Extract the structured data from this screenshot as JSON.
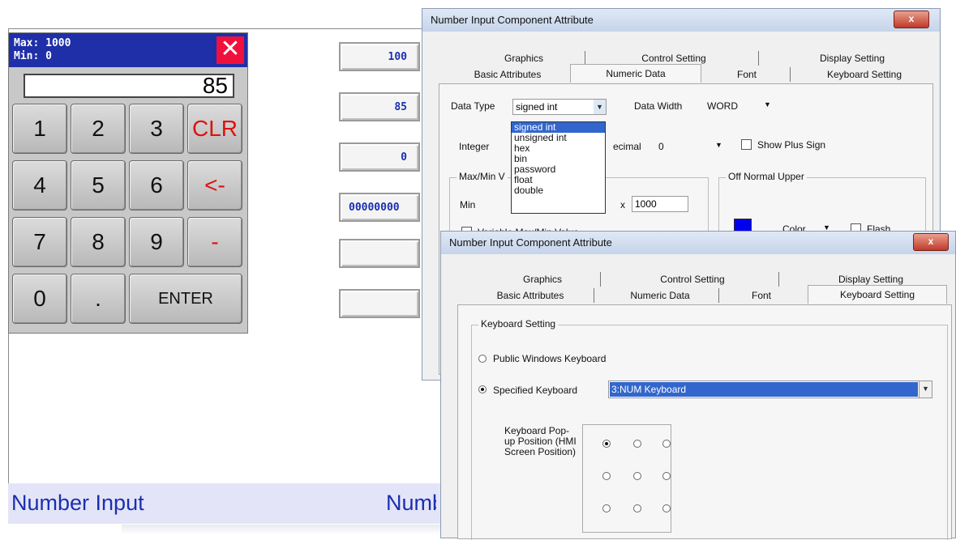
{
  "hmi": {
    "fields": [
      "100",
      "85",
      "0",
      "00000000",
      "",
      ""
    ],
    "bottom_label_left": "Number Input",
    "bottom_label_right": "Numb"
  },
  "keypad": {
    "max_label": "Max: 1000",
    "min_label": "Min: 0",
    "display_value": "85",
    "close_glyph": "✕",
    "keys": [
      "1",
      "2",
      "3",
      "CLR",
      "4",
      "5",
      "6",
      "<-",
      "7",
      "8",
      "9",
      "-",
      "0",
      ".",
      "ENTER"
    ]
  },
  "dialog1": {
    "title": "Number Input Component Attribute",
    "close": "x",
    "tabs_row1": [
      "Graphics",
      "Control Setting",
      "Display Setting"
    ],
    "tabs_row2": [
      "Basic Attributes",
      "Numeric Data",
      "Font",
      "Keyboard Setting"
    ],
    "active_tab": "Numeric Data",
    "data_type_label": "Data Type",
    "data_type_value": "signed int",
    "data_type_options": [
      "signed int",
      "unsigned int",
      "hex",
      "bin",
      "password",
      "float",
      "double"
    ],
    "data_width_label": "Data Width",
    "data_width_value": "WORD",
    "integer_label": "Integer",
    "decimal_label": "ecimal",
    "decimal_value": "0",
    "show_plus_label": "Show Plus Sign",
    "maxmin_group": "Max/Min V",
    "min_label": "Min",
    "min_value_fragment": "-",
    "max_label_fragment": "x",
    "max_value": "1000",
    "variable_maxmin_label": "Variable Max/Min Value",
    "off_normal_group": "Off Normal Upper",
    "color_label": "Color",
    "flash_label": "Flash",
    "color_swatch": "#0000ee"
  },
  "dialog2": {
    "title": "Number Input Component Attribute",
    "close": "x",
    "tabs_row1": [
      "Graphics",
      "Control Setting",
      "Display Setting"
    ],
    "tabs_row2": [
      "Basic Attributes",
      "Numeric Data",
      "Font",
      "Keyboard Setting"
    ],
    "active_tab": "Keyboard Setting",
    "group_label": "Keyboard Setting",
    "option_public": "Public Windows Keyboard",
    "option_specified": "Specified Keyboard",
    "specified_value": "3:NUM Keyboard",
    "popup_label": "Keyboard Pop-up Position (HMI Screen Position)"
  }
}
